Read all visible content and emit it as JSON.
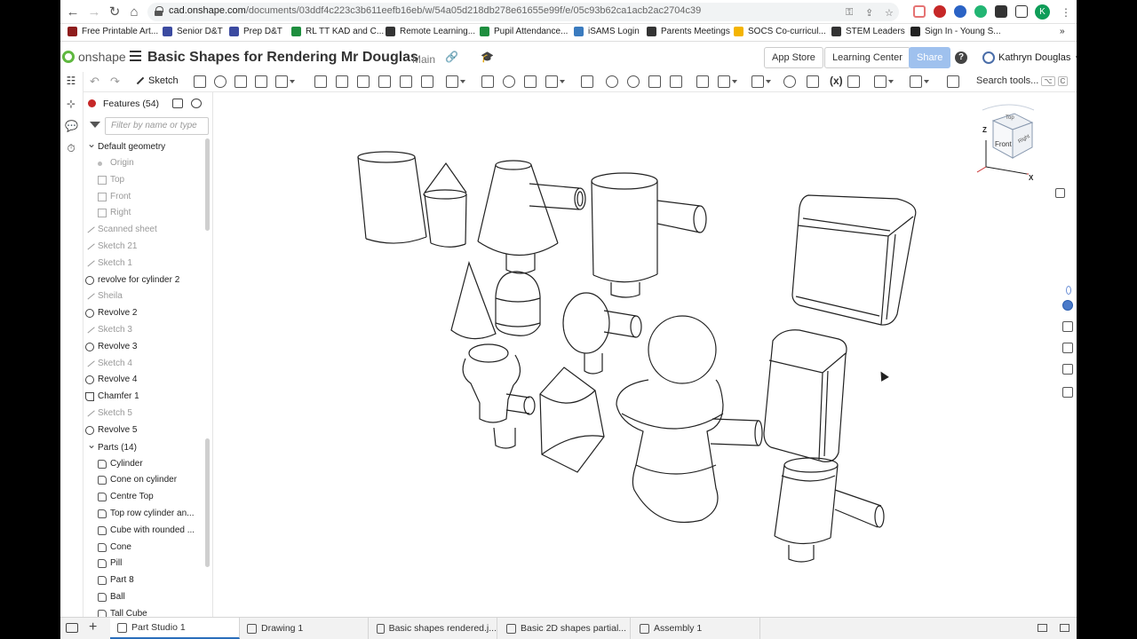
{
  "browser": {
    "url_host": "cad.onshape.com",
    "url_path": "/documents/03ddf4c223c3b611eefb16eb/w/54a05d218db278e61655e99f/e/05c93b62ca1acb2ac2704c39",
    "profile_initial": "K",
    "bookmarks": [
      {
        "label": "Free Printable Art...",
        "color": "#8e1c1c"
      },
      {
        "label": "Senior D&T",
        "color": "#3b4aa0"
      },
      {
        "label": "Prep D&T",
        "color": "#3b4aa0"
      },
      {
        "label": "RL TT KAD and C...",
        "color": "#1e8e3e"
      },
      {
        "label": "Remote Learning...",
        "color": "#333333"
      },
      {
        "label": "Pupil Attendance...",
        "color": "#1e8e3e"
      },
      {
        "label": "iSAMS Login",
        "color": "#3a7bbf"
      },
      {
        "label": "Parents Meetings",
        "color": "#333333"
      },
      {
        "label": "SOCS Co-curricul...",
        "color": "#f4b400"
      },
      {
        "label": "STEM Leaders",
        "color": "#333333"
      },
      {
        "label": "Sign In - Young S...",
        "color": "#222222"
      }
    ],
    "more_bookmarks": "»"
  },
  "header": {
    "logo": "onshape",
    "title": "Basic Shapes for Rendering Mr Douglas",
    "branch": "Main",
    "app_store": "App Store",
    "learning_center": "Learning Center",
    "share": "Share",
    "help": "?",
    "user": "Kathryn Douglas"
  },
  "toolbar": {
    "sketch_label": "Sketch",
    "search_label": "Search tools...",
    "search_shortcut_1": "⌥",
    "search_shortcut_2": "C"
  },
  "features": {
    "title": "Features (54)",
    "filter_placeholder": "Filter by name or type",
    "default_geometry_label": "Default geometry",
    "items": [
      {
        "label": "Origin",
        "type": "dot",
        "dim": true,
        "indent": 2
      },
      {
        "label": "Top",
        "type": "plane",
        "dim": true,
        "indent": 2
      },
      {
        "label": "Front",
        "type": "plane",
        "dim": true,
        "indent": 2
      },
      {
        "label": "Right",
        "type": "plane",
        "dim": true,
        "indent": 2
      },
      {
        "label": "Scanned sheet",
        "type": "pencil",
        "dim": true,
        "indent": 1
      },
      {
        "label": "Sketch 21",
        "type": "pencil",
        "dim": true,
        "indent": 1
      },
      {
        "label": "Sketch 1",
        "type": "pencil",
        "dim": true,
        "indent": 1
      },
      {
        "label": "revolve for cylinder 2",
        "type": "revolve",
        "dim": false,
        "indent": 1
      },
      {
        "label": "Sheila",
        "type": "pencil",
        "dim": true,
        "indent": 1
      },
      {
        "label": "Revolve 2",
        "type": "revolve",
        "dim": false,
        "indent": 1
      },
      {
        "label": "Sketch 3",
        "type": "pencil",
        "dim": true,
        "indent": 1
      },
      {
        "label": "Revolve 3",
        "type": "revolve",
        "dim": false,
        "indent": 1
      },
      {
        "label": "Sketch 4",
        "type": "pencil",
        "dim": true,
        "indent": 1
      },
      {
        "label": "Revolve 4",
        "type": "revolve",
        "dim": false,
        "indent": 1
      },
      {
        "label": "Chamfer 1",
        "type": "cham",
        "dim": false,
        "indent": 1
      },
      {
        "label": "Sketch 5",
        "type": "pencil",
        "dim": true,
        "indent": 1
      },
      {
        "label": "Revolve 5",
        "type": "revolve",
        "dim": false,
        "indent": 1
      }
    ],
    "parts_label": "Parts (14)",
    "parts": [
      "Cylinder",
      "Cone on cylinder",
      "Centre Top",
      "Top row cylinder an...",
      "Cube with rounded ...",
      "Cone",
      "Pill",
      "Part 8",
      "Ball",
      "Tall Cube"
    ]
  },
  "viewcube": {
    "top": "Top",
    "front": "Front",
    "right": "Right",
    "axis_z": "Z",
    "axis_x": "X"
  },
  "tabs": [
    {
      "label": "Part Studio 1",
      "active": true
    },
    {
      "label": "Drawing 1",
      "active": false
    },
    {
      "label": "Basic shapes rendered.j...",
      "active": false
    },
    {
      "label": "Basic 2D shapes partial...",
      "active": false
    },
    {
      "label": "Assembly 1",
      "active": false
    }
  ],
  "colors": {
    "onshape_green": "#5fb840",
    "share_button": "#9fc1ee",
    "active_tab": "#2a6ebb",
    "error_dot": "#c62828"
  }
}
